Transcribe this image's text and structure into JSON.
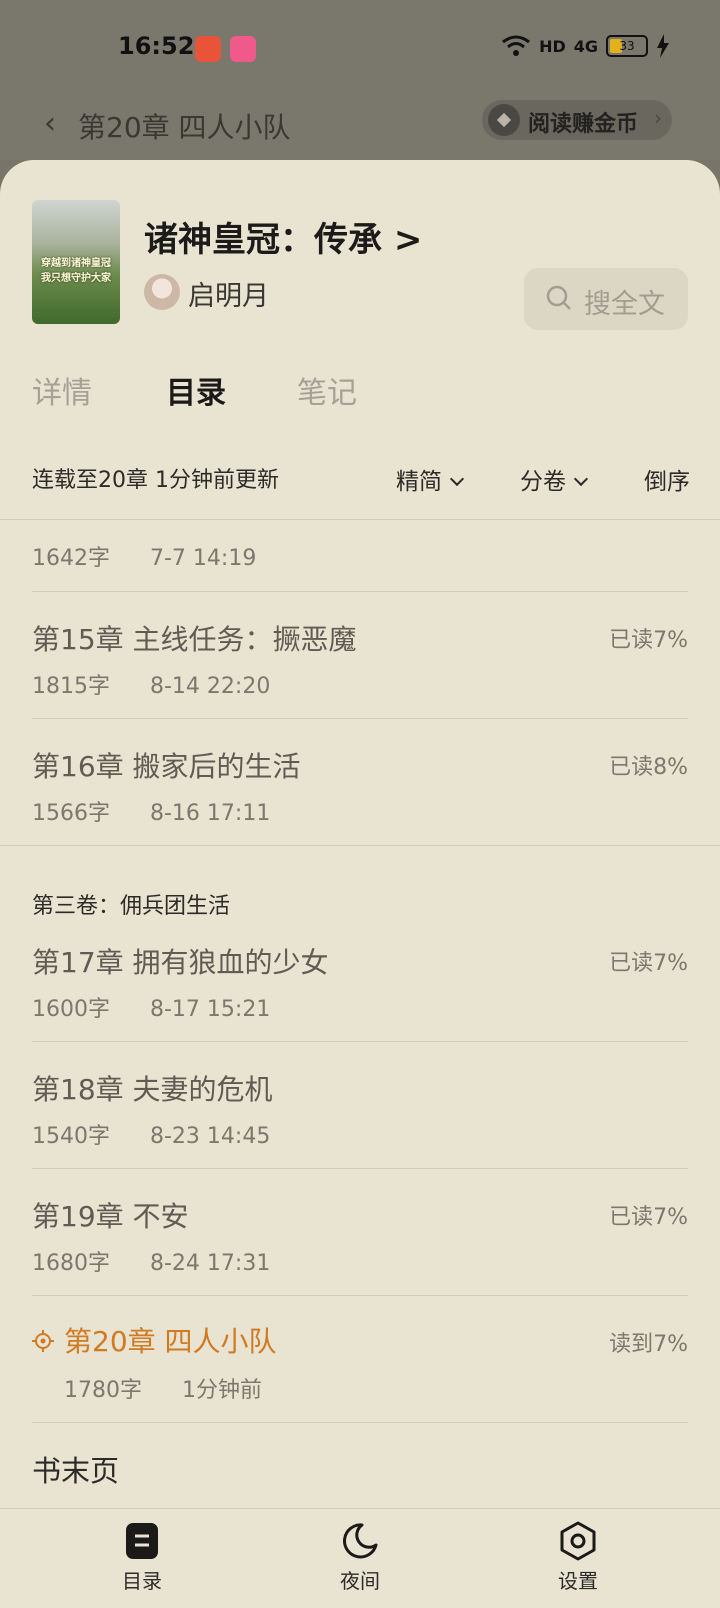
{
  "status_bar": {
    "time": "16:52",
    "network": "HD",
    "signal": "4G",
    "battery": "33"
  },
  "reader_bar": {
    "chapter_title": "第20章 四人小队",
    "coin_button": "阅读赚金币"
  },
  "book": {
    "cover_text": "穿越到诸神皇冠 我只想守护大家",
    "title": "诸神皇冠：传承",
    "title_arrow": ">",
    "author": "启明月",
    "search_placeholder": "搜全文"
  },
  "tabs": [
    "详情",
    "目录",
    "笔记"
  ],
  "filter": {
    "update_info": "连载至20章 1分钟前更新",
    "simplified": "精简",
    "volume": "分卷",
    "order": "倒序"
  },
  "chapters_top": [
    {
      "name": "",
      "words": "1642字",
      "date": "7-7 14:19",
      "read": ""
    },
    {
      "name": "第15章 主线任务：撅恶魔",
      "words": "1815字",
      "date": "8-14 22:20",
      "read": "已读7%"
    },
    {
      "name": "第16章 搬家后的生活",
      "words": "1566字",
      "date": "8-16 17:11",
      "read": "已读8%"
    }
  ],
  "volume_title": "第三卷：佣兵团生活",
  "chapters_vol3": [
    {
      "name": "第17章 拥有狼血的少女",
      "words": "1600字",
      "date": "8-17 15:21",
      "read": "已读7%"
    },
    {
      "name": "第18章 夫妻的危机",
      "words": "1540字",
      "date": "8-23 14:45",
      "read": ""
    },
    {
      "name": "第19章 不安",
      "words": "1680字",
      "date": "8-24 17:31",
      "read": "已读7%"
    }
  ],
  "current_chapter": {
    "name": "第20章 四人小队",
    "words": "1780字",
    "date": "1分钟前",
    "read": "读到7%"
  },
  "end_page": "书末页",
  "bottom_nav": {
    "toc": "目录",
    "night": "夜间",
    "settings": "设置"
  },
  "colors": {
    "sheet": "#e9e3d1",
    "accent": "#d07a22",
    "overlay": "#77746a"
  }
}
